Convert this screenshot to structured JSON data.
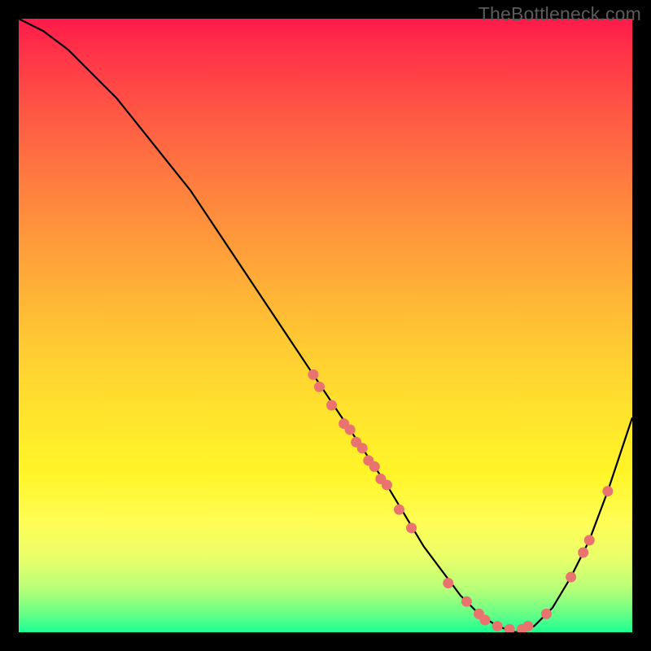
{
  "watermark": "TheBottleneck.com",
  "chart_data": {
    "type": "line",
    "title": "",
    "xlabel": "",
    "ylabel": "",
    "xlim": [
      0,
      100
    ],
    "ylim": [
      0,
      100
    ],
    "series": [
      {
        "name": "curve",
        "x": [
          0,
          4,
          8,
          12,
          16,
          20,
          24,
          28,
          32,
          36,
          40,
          44,
          48,
          52,
          56,
          60,
          63,
          66,
          69,
          72,
          75,
          78,
          81,
          84,
          87,
          90,
          93,
          96,
          100
        ],
        "y": [
          100,
          98,
          95,
          91,
          87,
          82,
          77,
          72,
          66,
          60,
          54,
          48,
          42,
          36,
          30,
          24,
          19,
          14,
          10,
          6,
          3,
          1,
          0,
          1,
          4,
          9,
          15,
          23,
          35
        ]
      }
    ],
    "markers": [
      {
        "x": 48,
        "y": 42
      },
      {
        "x": 49,
        "y": 40
      },
      {
        "x": 51,
        "y": 37
      },
      {
        "x": 53,
        "y": 34
      },
      {
        "x": 54,
        "y": 33
      },
      {
        "x": 55,
        "y": 31
      },
      {
        "x": 56,
        "y": 30
      },
      {
        "x": 57,
        "y": 28
      },
      {
        "x": 58,
        "y": 27
      },
      {
        "x": 59,
        "y": 25
      },
      {
        "x": 60,
        "y": 24
      },
      {
        "x": 62,
        "y": 20
      },
      {
        "x": 64,
        "y": 17
      },
      {
        "x": 70,
        "y": 8
      },
      {
        "x": 73,
        "y": 5
      },
      {
        "x": 75,
        "y": 3
      },
      {
        "x": 76,
        "y": 2
      },
      {
        "x": 78,
        "y": 1
      },
      {
        "x": 80,
        "y": 0.5
      },
      {
        "x": 82,
        "y": 0.5
      },
      {
        "x": 83,
        "y": 1
      },
      {
        "x": 86,
        "y": 3
      },
      {
        "x": 90,
        "y": 9
      },
      {
        "x": 92,
        "y": 13
      },
      {
        "x": 93,
        "y": 15
      },
      {
        "x": 96,
        "y": 23
      }
    ],
    "colors": {
      "curve": "#000000",
      "marker": "#e9736e"
    }
  }
}
